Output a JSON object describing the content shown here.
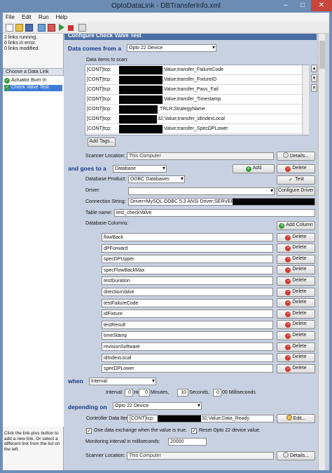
{
  "window": {
    "title": "OptoDataLink - DBTransferInfo.xml"
  },
  "menu": [
    "File",
    "Edit",
    "Run",
    "Help"
  ],
  "status": {
    "lines": [
      "2 links running.",
      "0 links in error.",
      "0 links modified."
    ]
  },
  "links": {
    "header": "Choose a Data Link",
    "items": [
      {
        "label": "Actuator Burn In"
      },
      {
        "label": "Check Valve Test"
      }
    ],
    "hint": "Click the link-plus button to add a new link. Or select a different link from the list on the left."
  },
  "form": {
    "banner": "Configure Check Valve Test",
    "source": {
      "title": "Data comes from a",
      "device": "Opto 22 Device",
      "items_label": "Data items to scan:",
      "items": [
        {
          "pre": "[CONT]tcp:",
          "post": ";Value;transfer_FailureCode"
        },
        {
          "pre": "[CONT]tcp:",
          "post": ";Value;transfer_FixtureID"
        },
        {
          "pre": "[CONT]tcp:",
          "post": ";Value;transfer_Pass_Fail"
        },
        {
          "pre": "[CONT]tcp:",
          "post": ";Value;transfer_Timestamp"
        },
        {
          "pre": "[CONT]tcp:",
          "post": ";TRLR;StrategyName"
        },
        {
          "pre": "[CONT]tcp:",
          "post": "32;Value;transfer_idIndexLocal"
        },
        {
          "pre": "[CONT]tcp:",
          "post": ";Value;transfer_SpecDPLower"
        }
      ],
      "add_tags": "Add Tags...",
      "scanner_label": "Scanner Location:",
      "scanner_value": "This Computer",
      "details": "Details..."
    },
    "dest": {
      "title": "and goes to a",
      "type": "Database",
      "add": "Add",
      "delete": "Delete",
      "product_label": "Database Product:",
      "product": "ODBC Databases",
      "test": "Test",
      "driver_label": "Driver:",
      "driver": "",
      "configure": "Configure Driver",
      "conn_label": "Connection String:",
      "conn": "Driver=MySQL ODBC 5.3 ANSI Driver;SERVER=",
      "table_label": "Table name:",
      "table": "test_checkValve",
      "columns_label": "Database Columns:",
      "add_column": "Add Column",
      "columns": [
        "flowBack",
        "dPForward",
        "specDPUpper",
        "specFlowBackMax",
        "testDuration",
        "directionValve",
        "testFailureCode",
        "idFixture",
        "testResult",
        "timeStamp",
        "revisionSoftware",
        "idIndexLocal",
        "specDPLower"
      ],
      "col_delete": "Delete"
    },
    "when": {
      "title": "when",
      "mode": "Interval",
      "interval_label": "Interval:",
      "hours": "0",
      "hours_label": "Hours:",
      "minutes": "0",
      "minutes_label": "Minutes,",
      "seconds": "10",
      "seconds_label": "Seconds,",
      "ms": "0",
      "ms_label": "00 Milliseconds"
    },
    "depending": {
      "title": "depending on",
      "device": "Opto 22 Device",
      "controller_label": "Controller Data Item:",
      "controller_pre": "[CONT]tcp:",
      "controller_post": "32;Value;Data_Ready",
      "edit": "Edit...",
      "opt1": "One data exchange when the value is true.",
      "opt2": "Reset Opto 22 device value.",
      "monitor_label": "Monitoring interval in milliseconds:",
      "monitor": "20000",
      "scanner_label": "Scanner Location:",
      "scanner_value": "This Computer",
      "details": "Details..."
    }
  }
}
